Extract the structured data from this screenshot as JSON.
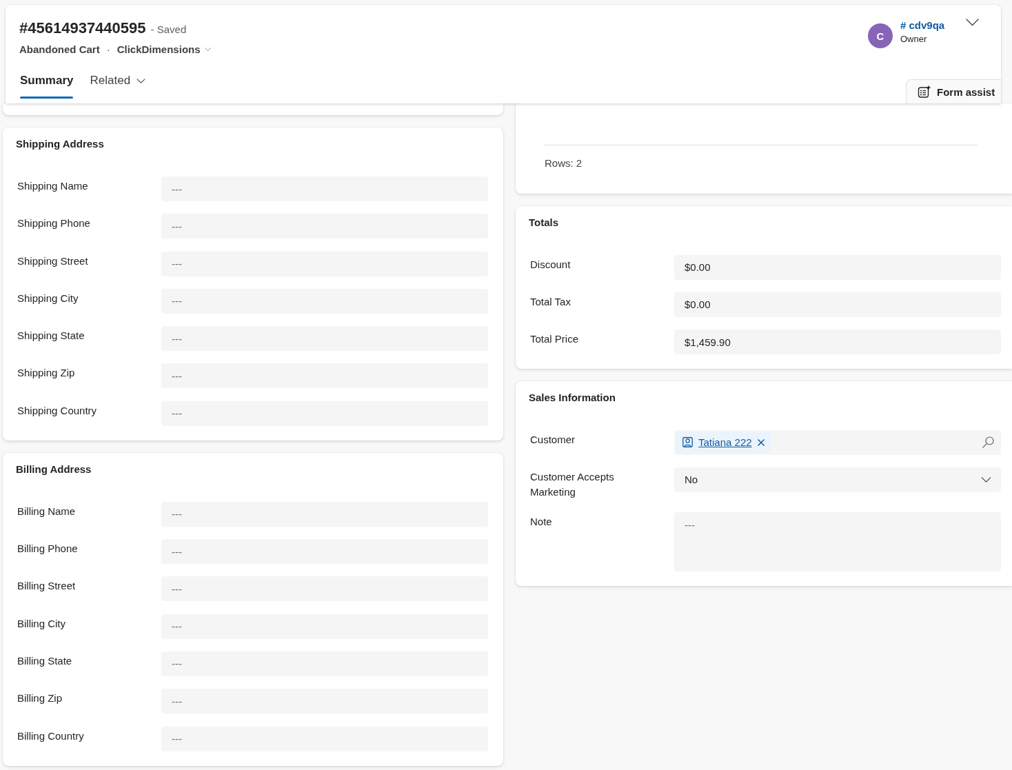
{
  "header": {
    "title": "#45614937440595",
    "save_status": "- Saved",
    "entity": "Abandoned Cart",
    "separator": "·",
    "form_selector": "ClickDimensions",
    "owner": {
      "initial": "C",
      "name": "# cdv9qa",
      "role": "Owner"
    },
    "tabs": [
      {
        "label": "Summary",
        "selected": true,
        "dropdown": false
      },
      {
        "label": "Related",
        "selected": false,
        "dropdown": true
      }
    ],
    "form_assist": "Form assist"
  },
  "left_column": [
    {
      "title": "Shipping Address",
      "fields": [
        {
          "kind": "text",
          "label": "Shipping Name",
          "placeholder": "---"
        },
        {
          "kind": "text",
          "label": "Shipping Phone",
          "placeholder": "---"
        },
        {
          "kind": "text",
          "label": "Shipping Street",
          "placeholder": "---"
        },
        {
          "kind": "text",
          "label": "Shipping City",
          "placeholder": "---"
        },
        {
          "kind": "text",
          "label": "Shipping State",
          "placeholder": "---"
        },
        {
          "kind": "text",
          "label": "Shipping Zip",
          "placeholder": "---"
        },
        {
          "kind": "text",
          "label": "Shipping Country",
          "placeholder": "---"
        }
      ]
    },
    {
      "title": "Billing Address",
      "fields": [
        {
          "kind": "text",
          "label": "Billing Name",
          "placeholder": "---"
        },
        {
          "kind": "text",
          "label": "Billing Phone",
          "placeholder": "---"
        },
        {
          "kind": "text",
          "label": "Billing Street",
          "placeholder": "---"
        },
        {
          "kind": "text",
          "label": "Billing City",
          "placeholder": "---"
        },
        {
          "kind": "text",
          "label": "Billing State",
          "placeholder": "---"
        },
        {
          "kind": "text",
          "label": "Billing Zip",
          "placeholder": "---"
        },
        {
          "kind": "text",
          "label": "Billing Country",
          "placeholder": "---"
        }
      ]
    }
  ],
  "right_column": {
    "grid": {
      "footer": "Rows: 2"
    },
    "sections": [
      {
        "title": "Totals",
        "fields": [
          {
            "kind": "text",
            "label": "Discount",
            "value": "$0.00"
          },
          {
            "kind": "text",
            "label": "Total Tax",
            "value": "$0.00"
          },
          {
            "kind": "text",
            "label": "Total Price",
            "value": "$1,459.90"
          }
        ]
      },
      {
        "title": "Sales Information",
        "fields": [
          {
            "kind": "lookup",
            "label": "Customer",
            "value": "Tatiana 222"
          },
          {
            "kind": "select",
            "label": "Customer Accepts Marketing",
            "value": "No"
          },
          {
            "kind": "textarea",
            "label": "Note",
            "placeholder": "---"
          }
        ]
      }
    ]
  }
}
